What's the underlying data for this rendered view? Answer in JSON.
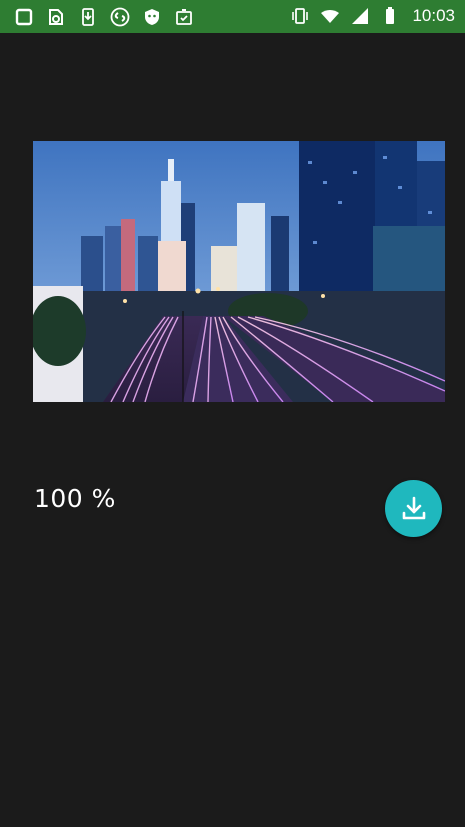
{
  "status_bar": {
    "time": "10:03",
    "background_color": "#2e7d32",
    "left_icons": [
      "square-notification-icon",
      "sync-app-icon",
      "download-notification-icon",
      "shazam-icon",
      "shield-app-icon",
      "clipboard-check-icon"
    ],
    "right_icons": [
      "vibrate-icon",
      "wifi-icon",
      "cellular-signal-icon",
      "battery-icon"
    ]
  },
  "progress": {
    "label": "100 %",
    "value": 100
  },
  "image": {
    "description_icon": "city-night-photo"
  },
  "download_button": {
    "icon": "download-icon",
    "color": "#1fb8be"
  }
}
